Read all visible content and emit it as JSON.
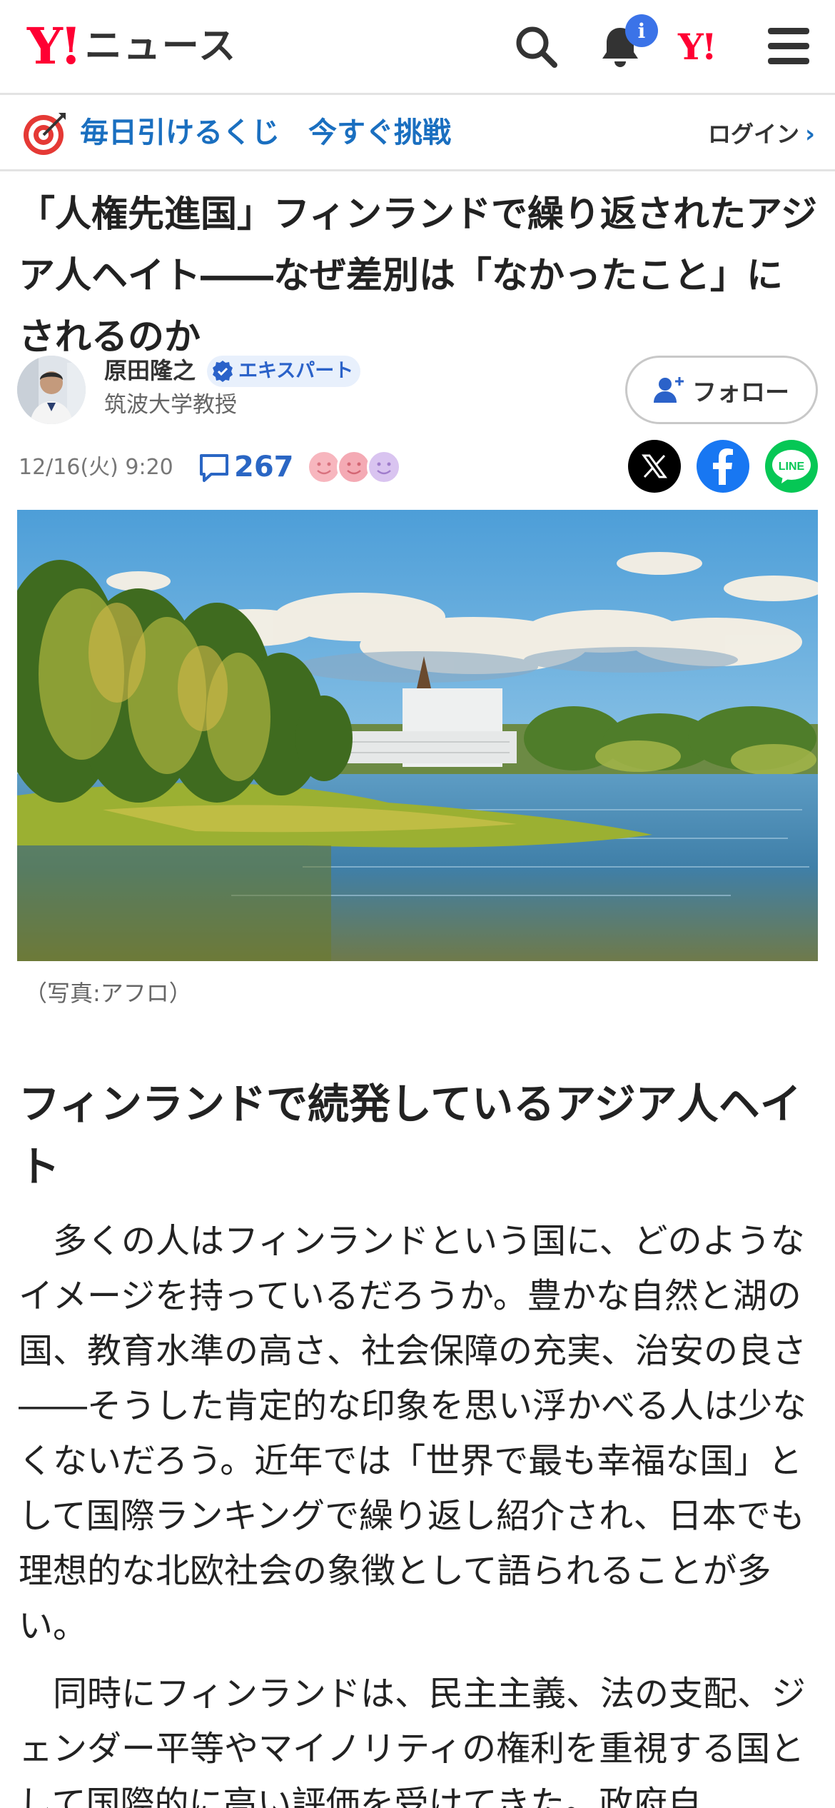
{
  "header": {
    "logo_mark": "Y!",
    "logo_text": "ニュース",
    "notification_badge": "i",
    "yahoo_mark": "Y!"
  },
  "promo": {
    "text": "毎日引けるくじ　今すぐ挑戦",
    "login": "ログイン",
    "login_chevron": "›"
  },
  "article": {
    "title": "「人権先進国」フィンランドで繰り返されたアジア人ヘイト――なぜ差別は「なかったこと」にされるのか",
    "author_name": "原田隆之",
    "expert_label": "エキスパート",
    "author_role": "筑波大学教授",
    "follow_label": "フォロー",
    "date": "12/16(火) 9:20",
    "comment_count": "267",
    "caption": "（写真:アフロ）",
    "heading": "フィンランドで続発しているアジア人ヘイト",
    "paragraphs": [
      "多くの人はフィンランドという国に、どのようなイメージを持っているだろうか。豊かな自然と湖の国、教育水準の高さ、社会保障の充実、治安の良さ――そうした肯定的な印象を思い浮かべる人は少なくないだろう。近年では「世界で最も幸福な国」として国際ランキングで繰り返し紹介され、日本でも理想的な北欧社会の象徴として語られることが多い。",
      "同時にフィンランドは、民主主義、法の支配、ジェンダー平等やマイノリティの権利を重視する国として国際的に高い評価を受けてきた。政府自"
    ]
  },
  "colors": {
    "brand_red": "#ff0033",
    "link_blue": "#1a6fc0",
    "x_black": "#000000",
    "facebook_blue": "#1877f2",
    "line_green": "#06c755"
  }
}
